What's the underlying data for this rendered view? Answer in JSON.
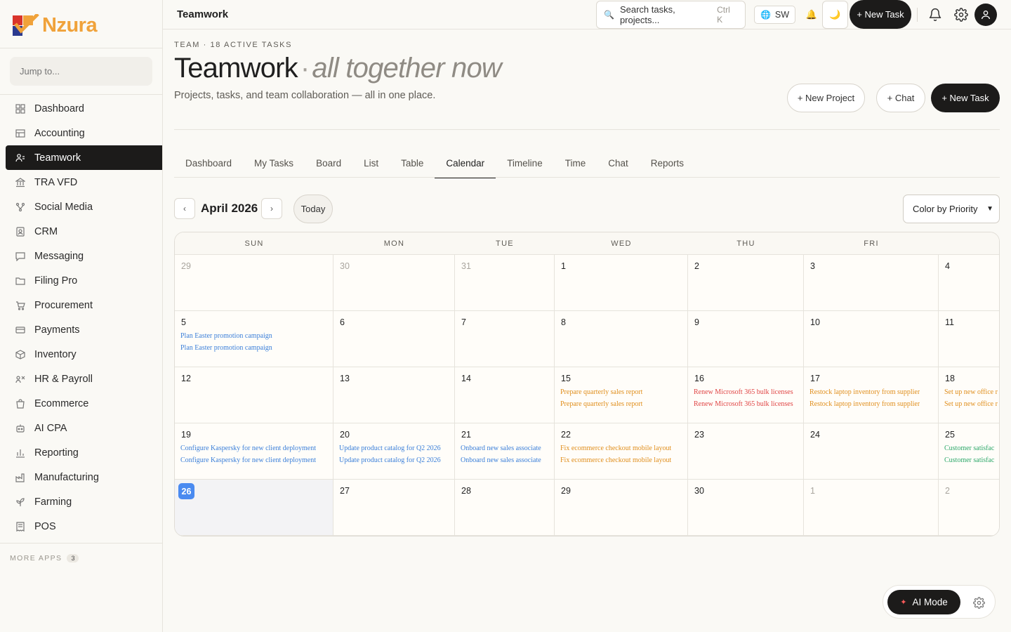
{
  "app": {
    "brand": "Nzura",
    "window_title": "Teamwork"
  },
  "sidebar": {
    "jump_placeholder": "Jump to...",
    "items": [
      {
        "label": "Dashboard",
        "icon": "grid-icon"
      },
      {
        "label": "Accounting",
        "icon": "ledger-icon"
      },
      {
        "label": "Teamwork",
        "icon": "team-icon",
        "active": true
      },
      {
        "label": "TRA VFD",
        "icon": "bank-icon"
      },
      {
        "label": "Social Media",
        "icon": "share-icon"
      },
      {
        "label": "CRM",
        "icon": "contact-icon"
      },
      {
        "label": "Messaging",
        "icon": "chat-icon"
      },
      {
        "label": "Filing Pro",
        "icon": "folder-icon"
      },
      {
        "label": "Procurement",
        "icon": "cart-icon"
      },
      {
        "label": "Payments",
        "icon": "card-icon"
      },
      {
        "label": "Inventory",
        "icon": "box-icon"
      },
      {
        "label": "HR & Payroll",
        "icon": "people-icon"
      },
      {
        "label": "Ecommerce",
        "icon": "bag-icon"
      },
      {
        "label": "AI CPA",
        "icon": "robot-icon"
      },
      {
        "label": "Reporting",
        "icon": "chart-icon"
      },
      {
        "label": "Manufacturing",
        "icon": "factory-icon"
      },
      {
        "label": "Farming",
        "icon": "plant-icon"
      },
      {
        "label": "POS",
        "icon": "receipt-icon"
      }
    ],
    "more_apps_label": "MORE APPS",
    "more_apps_count": "3"
  },
  "topbar": {
    "title": "Teamwork",
    "search_placeholder": "Search tasks, projects...",
    "search_shortcut": "Ctrl K",
    "language": "SW",
    "new_task_label": "+ New Task"
  },
  "header": {
    "eyebrow": "TEAM · 18 ACTIVE TASKS",
    "title": "Teamwork",
    "tagline": "all together now",
    "subtitle": "Projects, tasks, and team collaboration — all in one place.",
    "new_project_label": "+  New Project",
    "chat_label": "+  Chat",
    "new_task_label": "+  New Task"
  },
  "tabs": [
    {
      "label": "Dashboard"
    },
    {
      "label": "My Tasks"
    },
    {
      "label": "Board"
    },
    {
      "label": "List"
    },
    {
      "label": "Table"
    },
    {
      "label": "Calendar",
      "active": true
    },
    {
      "label": "Timeline"
    },
    {
      "label": "Time"
    },
    {
      "label": "Chat"
    },
    {
      "label": "Reports"
    }
  ],
  "calendar": {
    "prev_label": "‹",
    "next_label": "›",
    "month_label": "April 2026",
    "today_label": "Today",
    "color_by": "Color by Priority",
    "weekdays": [
      "SUN",
      "MON",
      "TUE",
      "WED",
      "THU",
      "FRI"
    ],
    "weeks": [
      [
        {
          "day": "29",
          "muted": true,
          "events": []
        },
        {
          "day": "30",
          "muted": true,
          "events": []
        },
        {
          "day": "31",
          "muted": true,
          "events": []
        },
        {
          "day": "1",
          "events": []
        },
        {
          "day": "2",
          "events": []
        },
        {
          "day": "3",
          "events": []
        },
        {
          "day": "4",
          "events": []
        }
      ],
      [
        {
          "day": "5",
          "events": [
            {
              "title": "Plan Easter promotion campaign",
              "color": "blue"
            },
            {
              "title": "Plan Easter promotion campaign",
              "color": "blue"
            }
          ]
        },
        {
          "day": "6",
          "events": []
        },
        {
          "day": "7",
          "events": []
        },
        {
          "day": "8",
          "events": []
        },
        {
          "day": "9",
          "events": []
        },
        {
          "day": "10",
          "events": []
        },
        {
          "day": "11",
          "events": []
        }
      ],
      [
        {
          "day": "12",
          "events": []
        },
        {
          "day": "13",
          "events": []
        },
        {
          "day": "14",
          "events": []
        },
        {
          "day": "15",
          "events": [
            {
              "title": "Prepare quarterly sales report",
              "color": "orange"
            },
            {
              "title": "Prepare quarterly sales report",
              "color": "orange"
            }
          ]
        },
        {
          "day": "16",
          "events": [
            {
              "title": "Renew Microsoft 365 bulk licenses",
              "color": "red"
            },
            {
              "title": "Renew Microsoft 365 bulk licenses",
              "color": "red"
            }
          ]
        },
        {
          "day": "17",
          "events": [
            {
              "title": "Restock laptop inventory from supplier",
              "color": "orange"
            },
            {
              "title": "Restock laptop inventory from supplier",
              "color": "orange"
            }
          ]
        },
        {
          "day": "18",
          "events": [
            {
              "title": "Set up new office r",
              "color": "orange"
            },
            {
              "title": "Set up new office r",
              "color": "orange"
            }
          ]
        }
      ],
      [
        {
          "day": "19",
          "events": [
            {
              "title": "Configure Kaspersky for new client deployment",
              "color": "blue"
            },
            {
              "title": "Configure Kaspersky for new client deployment",
              "color": "blue"
            }
          ]
        },
        {
          "day": "20",
          "events": [
            {
              "title": "Update product catalog for Q2 2026",
              "color": "blue"
            },
            {
              "title": "Update product catalog for Q2 2026",
              "color": "blue"
            }
          ]
        },
        {
          "day": "21",
          "events": [
            {
              "title": "Onboard new sales associate",
              "color": "blue"
            },
            {
              "title": "Onboard new sales associate",
              "color": "blue"
            }
          ]
        },
        {
          "day": "22",
          "events": [
            {
              "title": "Fix ecommerce checkout mobile layout",
              "color": "orange"
            },
            {
              "title": "Fix ecommerce checkout mobile layout",
              "color": "orange"
            }
          ]
        },
        {
          "day": "23",
          "events": []
        },
        {
          "day": "24",
          "events": []
        },
        {
          "day": "25",
          "events": [
            {
              "title": "Customer satisfac",
              "color": "green"
            },
            {
              "title": "Customer satisfac",
              "color": "green"
            }
          ]
        }
      ],
      [
        {
          "day": "26",
          "today": true,
          "events": []
        },
        {
          "day": "27",
          "events": []
        },
        {
          "day": "28",
          "events": []
        },
        {
          "day": "29",
          "events": []
        },
        {
          "day": "30",
          "events": []
        },
        {
          "day": "1",
          "muted": true,
          "events": []
        },
        {
          "day": "2",
          "muted": true,
          "events": []
        }
      ]
    ]
  },
  "ai": {
    "mode_label": "AI Mode"
  },
  "colors": {
    "blue": "#3b7fd9",
    "orange": "#e08e1c",
    "red": "#e04545",
    "green": "#2ea86a",
    "today": "#4a8af0",
    "dark": "#1c1b1a"
  }
}
